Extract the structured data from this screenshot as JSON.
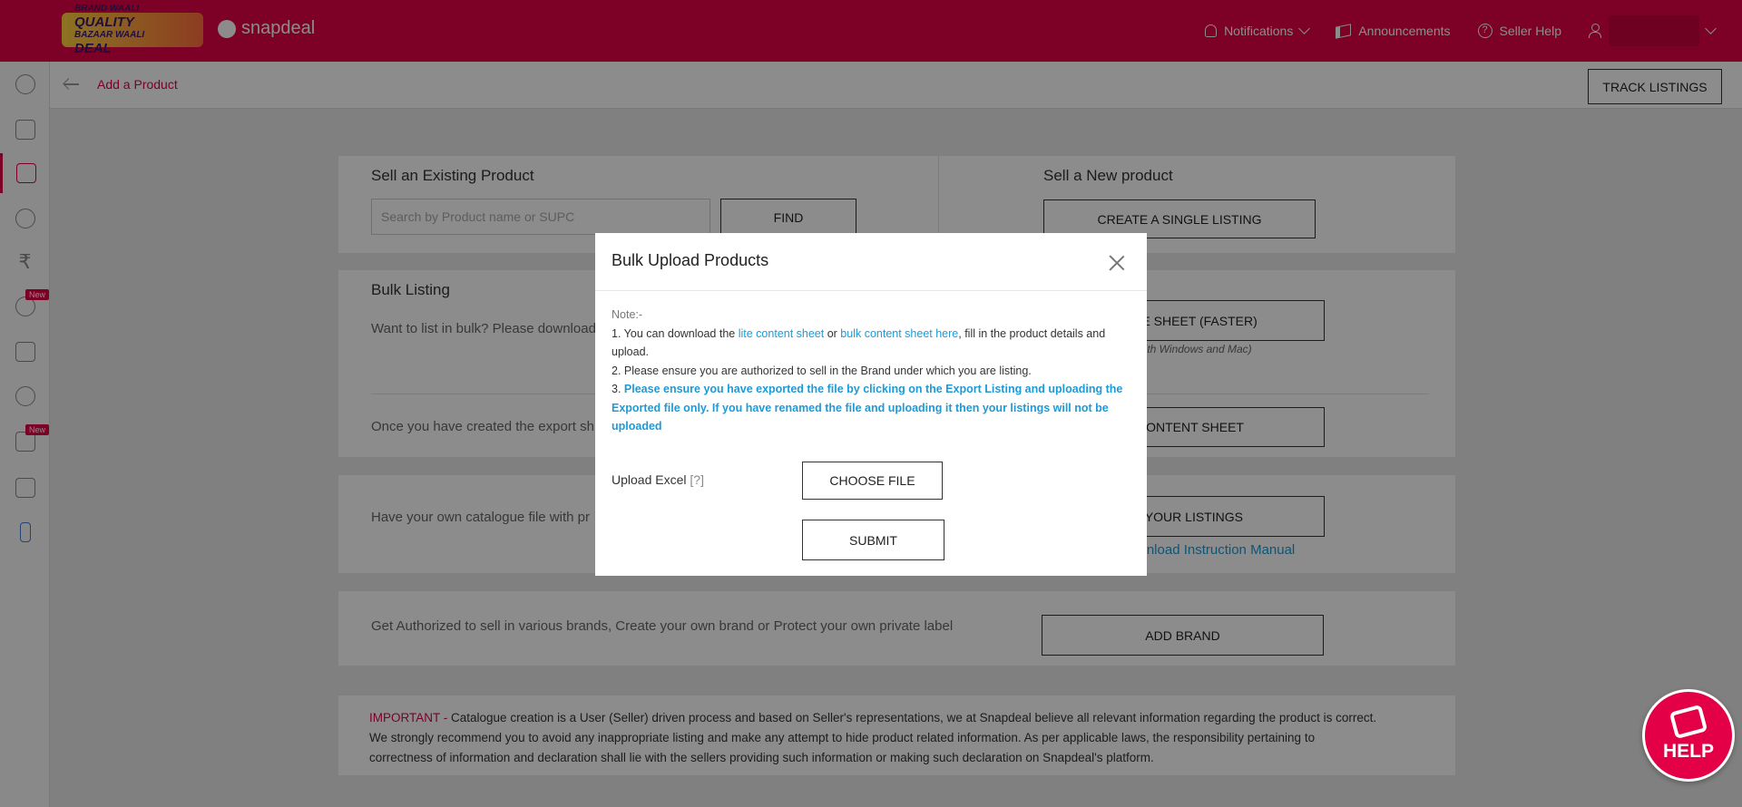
{
  "topbar": {
    "promo_line1": "BRAND WAALI",
    "promo_line2": "QUALITY",
    "promo_line3": "BAZAAR WAALI",
    "promo_line4": "DEAL",
    "brand": "snapdeal",
    "nav": [
      {
        "label": "Notifications",
        "icon": "bell-icon"
      },
      {
        "label": "Announcements",
        "icon": "megaphone-icon"
      },
      {
        "label": "Seller Help",
        "icon": "help-circle-icon"
      }
    ]
  },
  "sidebar": {
    "items": [
      {
        "icon": "dashboard-icon"
      },
      {
        "icon": "orders-cart-icon"
      },
      {
        "icon": "catalogue-book-icon",
        "active": true
      },
      {
        "icon": "returns-icon"
      },
      {
        "icon": "rupee-icon"
      },
      {
        "icon": "advertising-icon",
        "badge": "New"
      },
      {
        "icon": "analytics-bars-icon"
      },
      {
        "icon": "promotions-percent-icon"
      },
      {
        "icon": "growth-chart-icon",
        "badge": "New"
      },
      {
        "icon": "tools-wrench-icon"
      },
      {
        "icon": "mobile-app-icon"
      }
    ]
  },
  "header": {
    "breadcrumb": "Add a Product",
    "track_listings": "TRACK LISTINGS"
  },
  "existing": {
    "title": "Sell an Existing Product",
    "search_placeholder": "Search by Product name or SUPC",
    "find": "FIND"
  },
  "new_product": {
    "title": "Sell a New product",
    "create_single": "CREATE A SINGLE LISTING"
  },
  "bulk": {
    "title": "Bulk Listing",
    "text1": "Want to list in bulk? Please download",
    "lite_sheet_btn": "D LITE SHEET (FASTER)",
    "compat": "e with Windows and Mac)",
    "text2": "Once you have created the export sh",
    "content_sheet_btn": "D CONTENT SHEET"
  },
  "catalogue": {
    "text": "Have your own catalogue file with pr",
    "import_btn": "RT YOUR LISTINGS",
    "manual_link": "wnload Instruction Manual"
  },
  "brand_card": {
    "text": "Get Authorized to sell in various brands, Create your own brand or Protect your own private label",
    "add_brand": "ADD BRAND"
  },
  "important": {
    "label": "IMPORTANT -",
    "line1": " Catalogue creation is a User (Seller) driven process and based on Seller's representations, we at Snapdeal believe all relevant information regarding the product is correct.",
    "line2": "We strongly recommend you to avoid any inappropriate listing and make any attempt to hide product related information. As per applicable laws, the responsibility pertaining to",
    "line3": "correctness of information and declaration shall lie with the sellers providing such information or making such declaration on Snapdeal's platform."
  },
  "modal": {
    "title": "Bulk Upload Products",
    "note_head": "Note:-",
    "n1_pre": "1. You can download the ",
    "n1_link1": "lite content sheet",
    "n1_mid": " or ",
    "n1_link2": "bulk content sheet here",
    "n1_post": ", fill in the product details and upload.",
    "n2": "2. Please ensure you are authorized to sell in the Brand under which you are listing.",
    "n3_num": "3. ",
    "n3": "Please ensure you have exported the file by clicking on the Export Listing and uploading the Exported file only. If you have renamed the file and uploading it then your listings will not be uploaded",
    "upload_label": "Upload Excel",
    "upload_hint": "[?]",
    "choose_file": "CHOOSE FILE",
    "submit": "SUBMIT"
  },
  "help_bubble": {
    "label": "HELP"
  },
  "colors": {
    "brand": "#e40046",
    "link": "#1e9ad6",
    "overlay": "rgba(0,0,0,0.45)"
  }
}
